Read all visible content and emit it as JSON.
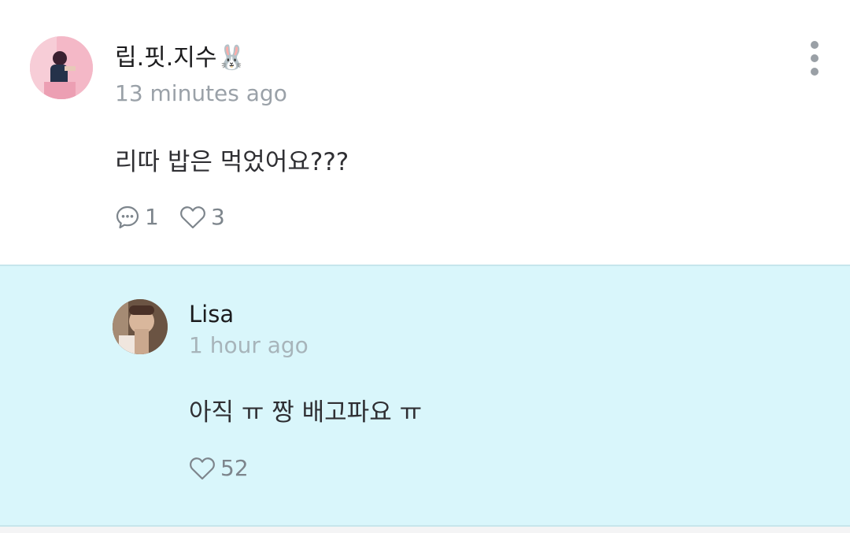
{
  "comment": {
    "author": "립.핏.지수🐰",
    "time": "13 minutes ago",
    "text": "리따 밥은 먹었어요???",
    "reply_count": "1",
    "like_count": "3",
    "icons": [
      "avatar",
      "comment-bubble-icon",
      "heart-icon",
      "more-vertical-icon"
    ]
  },
  "reply": {
    "author": "Lisa",
    "time": "1 hour ago",
    "text": "아직 ㅠ 짱 배고파요 ㅠ",
    "like_count": "52",
    "background_color": "#d9f6fb",
    "icons": [
      "avatar",
      "heart-icon"
    ]
  }
}
